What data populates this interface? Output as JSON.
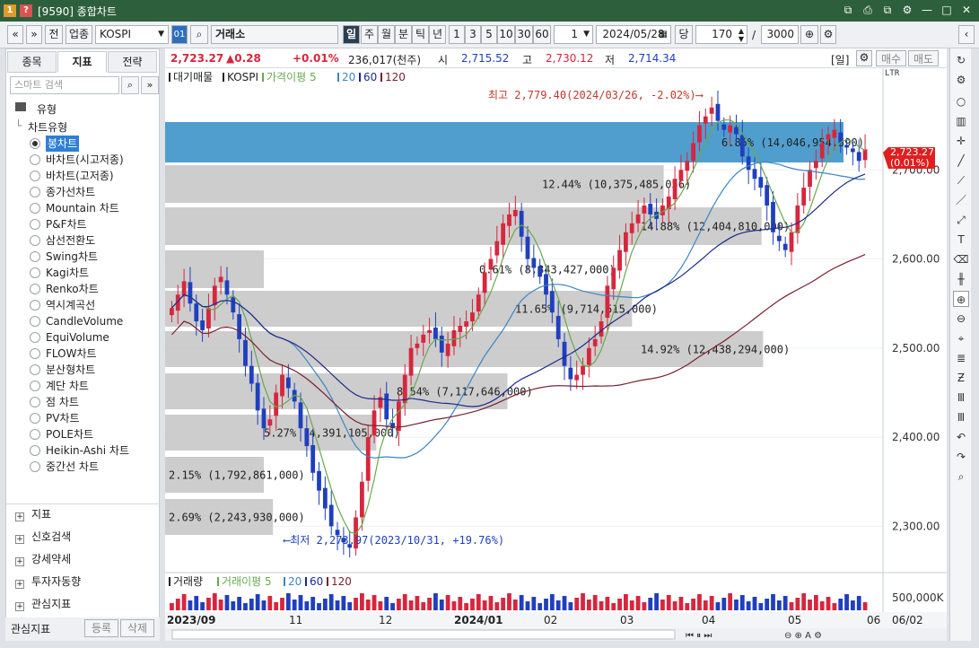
{
  "window": {
    "badge_one": "1",
    "badge_q": "?",
    "title": "[9590] 종합차트",
    "controls": [
      "⧉",
      "⎙",
      "⧉",
      "⚙",
      "—",
      "□",
      "✕"
    ]
  },
  "toolbar": {
    "nav_prev": "«",
    "nav_down": "»",
    "btn_jeon": "전",
    "btn_upjong": "업종",
    "symbol": "KOSPI",
    "code_badge": "01",
    "market": "거래소",
    "periods": [
      "일",
      "주",
      "월",
      "분",
      "틱",
      "년"
    ],
    "minutes": [
      "1",
      "3",
      "5",
      "10",
      "30",
      "60"
    ],
    "unit_value": "1",
    "date": "2024/05/28",
    "dang": "당",
    "count": "170",
    "slash": "/",
    "total": "3000"
  },
  "price_bar": {
    "current": "2,723.27",
    "change": "▲0.28",
    "change_pct": "+0.01%",
    "volume": "236,017(천주)",
    "open_label": "시",
    "open": "2,715.52",
    "high_label": "고",
    "high": "2,730.12",
    "low_label": "저",
    "low": "2,714.34",
    "period_tag": "[일]",
    "buy": "매수",
    "sell": "매도"
  },
  "left_panel": {
    "tabs": [
      "종목",
      "지표",
      "전략"
    ],
    "active_tab": 1,
    "search_placeholder": "스마트 검색",
    "section_title": "유형",
    "group_title": "차트유형",
    "chart_types": [
      "봉차트",
      "바차트(시고저종)",
      "바차트(고저종)",
      "종가선차트",
      "Mountain 차트",
      "P&F차트",
      "삼선전환도",
      "Swing차트",
      "Kagi차트",
      "Renko차트",
      "역시계곡선",
      "CandleVolume",
      "EquiVolume",
      "FLOW차트",
      "분산형차트",
      "계단 차트",
      "점 차트",
      "PV차트",
      "POLE차트",
      "Heikin-Ashi 차트",
      "중간선 차트"
    ],
    "selected_type": 0,
    "accordions": [
      "지표",
      "신호검색",
      "강세약세",
      "투자자동향",
      "관심지표"
    ],
    "bottom_label": "관심지표",
    "bottom_buttons": [
      "등록",
      "삭제"
    ]
  },
  "chart": {
    "legend": [
      "대기매물",
      "KOSPI",
      "가격이평 5",
      "20",
      "60",
      "120"
    ],
    "ltr": "LTR",
    "vol_legend": [
      "거래량",
      "거래이평 5",
      "20",
      "60",
      "120"
    ],
    "high_annotation": "최고 2,779.40(2024/03/26, -2.02%)⟶",
    "low_annotation": "⟵최저 2,273.97(2023/10/31, +19.76%)",
    "current_tag": "2,723.27",
    "current_tag_pct": "(0.01%)",
    "y_labels": [
      "2,700.00",
      "2,600.00",
      "2,500.00",
      "2,400.00",
      "2,300.00"
    ],
    "vol_label": "500,000K",
    "x_labels": [
      "2023/09",
      "11",
      "12",
      "2024/01",
      "02",
      "03",
      "04",
      "05",
      "06"
    ],
    "x_last": "06/02",
    "volume_profile": [
      {
        "label": "6.85% (14,046,954,590)"
      },
      {
        "label": "12.44% (10,375,485,056)"
      },
      {
        "label": "14.88% (12,404,810,000)"
      },
      {
        "label": "0.61% (8,843,427,000)"
      },
      {
        "label": "11.65% (9,714,515,000)"
      },
      {
        "label": "14.92% (12,438,294,000)"
      },
      {
        "label": "8.54% (7,117,646,000)"
      },
      {
        "label": "5.27% (4,391,105,000)"
      },
      {
        "label": "2.15% (1,792,861,000)"
      },
      {
        "label": "2.69% (2,243,930,000)"
      }
    ],
    "colors": {
      "up": "#d7263d",
      "down": "#1f3fbf",
      "ma5": "#6aa84f",
      "ma20": "#3d85c6",
      "ma60": "#1c2a8a",
      "ma120": "#7a1f2e",
      "profile": "#c8c8c8",
      "profile_hi": "#3d94c9"
    }
  },
  "chart_data": {
    "type": "candlestick",
    "title": "KOSPI",
    "xlabel": "",
    "ylabel": "",
    "ylim": [
      2250,
      2800
    ],
    "x_start": "2023/09",
    "x_end": "2024/05/28",
    "series_close": [
      2545,
      2560,
      2575,
      2550,
      2530,
      2520,
      2545,
      2570,
      2580,
      2560,
      2540,
      2510,
      2480,
      2460,
      2430,
      2410,
      2420,
      2450,
      2470,
      2455,
      2440,
      2410,
      2390,
      2360,
      2340,
      2320,
      2300,
      2290,
      2282,
      2276,
      2310,
      2350,
      2400,
      2430,
      2445,
      2420,
      2410,
      2440,
      2470,
      2500,
      2505,
      2515,
      2520,
      2510,
      2495,
      2505,
      2520,
      2525,
      2530,
      2540,
      2560,
      2585,
      2600,
      2620,
      2640,
      2650,
      2655,
      2625,
      2600,
      2590,
      2580,
      2560,
      2540,
      2510,
      2480,
      2465,
      2470,
      2480,
      2500,
      2510,
      2530,
      2570,
      2590,
      2610,
      2630,
      2640,
      2650,
      2660,
      2650,
      2645,
      2660,
      2670,
      2690,
      2700,
      2710,
      2730,
      2750,
      2760,
      2770,
      2755,
      2745,
      2750,
      2740,
      2715,
      2700,
      2690,
      2680,
      2660,
      2630,
      2620,
      2610,
      2630,
      2660,
      2680,
      2700,
      2710,
      2730,
      2740,
      2745,
      2730,
      2725,
      2720,
      2710,
      2723
    ],
    "indicators": [
      "가격이평 5",
      "20",
      "60",
      "120"
    ],
    "volume_profile_pct": [
      6.85,
      12.44,
      14.88,
      0.61,
      11.65,
      14.92,
      8.54,
      5.27,
      2.15,
      2.69
    ]
  }
}
